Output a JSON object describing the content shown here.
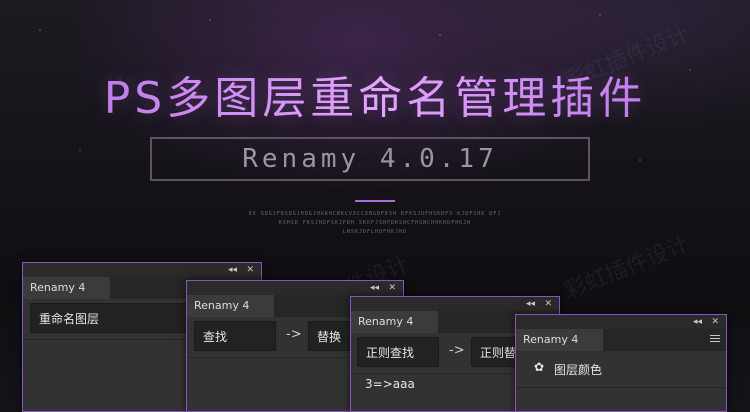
{
  "banner": {
    "title": "PS多图层重命名管理插件",
    "version": "Renamy 4.0.17",
    "tiny_lines": [
      "DV SDGJFBSDGJHDGJHGKHCBKCVXCCXBGDFKSH DFKSJDFHSKDFS KJDFSHK DFJ",
      "KSHSD FKSJHDFSKJFDH SKDFJSHFDKSHCFHSNCHHKHDFHKJH",
      "LNSKJDFLHDFHKJHD"
    ],
    "watermark": "彩虹插件设计"
  },
  "panels": [
    {
      "title": "Renamy 4",
      "field1": "重命名图层"
    },
    {
      "title": "Renamy 4",
      "field1": "查找",
      "field2": "替换"
    },
    {
      "title": "Renamy 4",
      "field1": "正则查找",
      "field2": "正则替",
      "extra": "3=>aaa"
    },
    {
      "title": "Renamy 4",
      "item": "图层颜色"
    }
  ],
  "controls": {
    "collapse": "◂◂",
    "close": "✕",
    "arrow": "->"
  },
  "colors": {
    "accent": "#b06ad8",
    "panel_border": "#8a53c4",
    "panel_bg": "#323232"
  }
}
